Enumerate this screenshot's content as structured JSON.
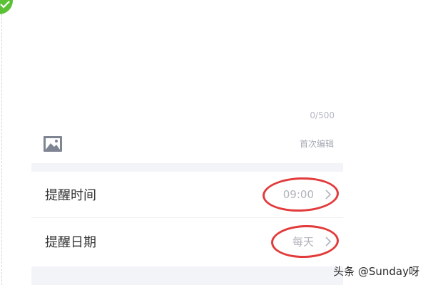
{
  "editor": {
    "char_counter": "0/500",
    "image_icon": "image-icon",
    "first_edit_label": "首次编辑"
  },
  "reminder_rows": [
    {
      "label": "提醒时间",
      "value": "09:00",
      "icon": "chevron-right-icon"
    },
    {
      "label": "提醒日期",
      "value": "每天",
      "icon": "chevron-right-icon"
    }
  ],
  "annotations": {
    "circle_color": "#e23b3b"
  },
  "watermark": {
    "text": "头条 @Sunday呀"
  },
  "colors": {
    "accent_badge": "#5bc236",
    "muted_text": "#b0b3bb",
    "section_bg": "#f3f4f8"
  }
}
